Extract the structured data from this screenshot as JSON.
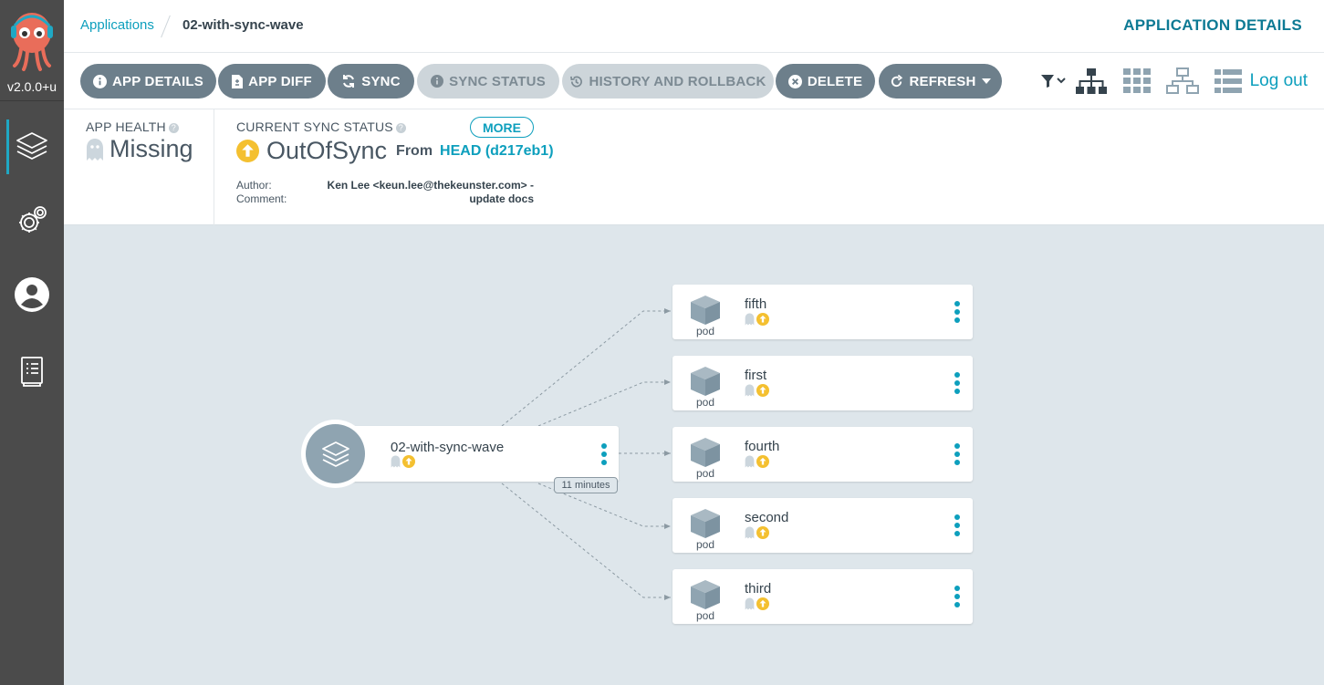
{
  "sidebar": {
    "version": "v2.0.0+u",
    "nav": [
      {
        "name": "applications",
        "icon": "layers-icon",
        "active": true
      },
      {
        "name": "settings",
        "icon": "gears-icon",
        "active": false
      },
      {
        "name": "user-info",
        "icon": "user-circle-icon",
        "active": false
      },
      {
        "name": "documentation",
        "icon": "book-icon",
        "active": false
      }
    ]
  },
  "breadcrumb": {
    "root": "Applications",
    "current": "02-with-sync-wave"
  },
  "header": {
    "title": "APPLICATION DETAILS"
  },
  "toolbar": {
    "app_details": "APP DETAILS",
    "app_diff": "APP DIFF",
    "sync": "SYNC",
    "sync_status": "SYNC STATUS",
    "history": "HISTORY AND ROLLBACK",
    "delete": "DELETE",
    "refresh": "REFRESH",
    "logout": "Log out"
  },
  "status": {
    "health_label": "APP HEALTH",
    "health_value": "Missing",
    "sync_label": "CURRENT SYNC STATUS",
    "more": "MORE",
    "sync_value": "OutOfSync",
    "from": "From",
    "revision": "HEAD (d217eb1)",
    "author_label": "Author:",
    "author_value": "Ken Lee <keun.lee@thekeunster.com> -",
    "comment_label": "Comment:",
    "comment_value": "update docs"
  },
  "graph": {
    "app_node": {
      "name": "02-with-sync-wave",
      "age": "11 minutes"
    },
    "pods": [
      {
        "name": "fifth",
        "kind": "pod"
      },
      {
        "name": "first",
        "kind": "pod"
      },
      {
        "name": "fourth",
        "kind": "pod"
      },
      {
        "name": "second",
        "kind": "pod"
      },
      {
        "name": "third",
        "kind": "pod"
      }
    ]
  },
  "colors": {
    "accent": "#0d9fbd",
    "sidebar": "#4b4b4b",
    "button": "#6d7f8b",
    "out_of_sync": "#f4c030",
    "canvas": "#dee6eb"
  }
}
